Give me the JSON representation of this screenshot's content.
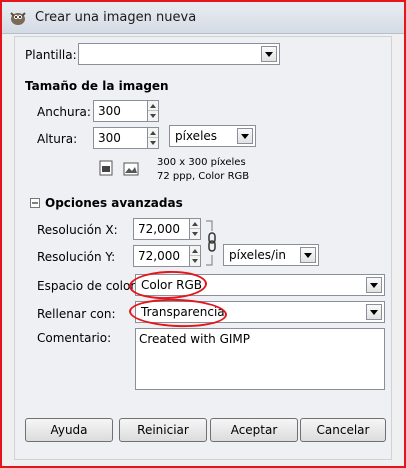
{
  "window": {
    "title": "Crear una imagen nueva"
  },
  "template": {
    "label": "Plantilla:",
    "value": ""
  },
  "image_size": {
    "heading": "Tamaño de la imagen",
    "width_label": "Anchura:",
    "width_value": "300",
    "height_label": "Altura:",
    "height_value": "300",
    "unit": "píxeles",
    "info_line1": "300 x 300 píxeles",
    "info_line2": "72 ppp, Color RGB"
  },
  "advanced": {
    "heading": "Opciones avanzadas",
    "res_x_label": "Resolución X:",
    "res_x_value": "72,000",
    "res_y_label": "Resolución Y:",
    "res_y_value": "72,000",
    "res_unit": "píxeles/in",
    "colorspace_label": "Espacio de color:",
    "colorspace_value": "Color RGB",
    "fill_label": "Rellenar con:",
    "fill_value": "Transparencia",
    "comment_label": "Comentario:",
    "comment_value": "Created with GIMP"
  },
  "buttons": {
    "help": "Ayuda",
    "reset": "Reiniciar",
    "ok": "Aceptar",
    "cancel": "Cancelar"
  },
  "colors": {
    "annotation": "#e3161b",
    "window_bg": "#f0f0f0"
  }
}
